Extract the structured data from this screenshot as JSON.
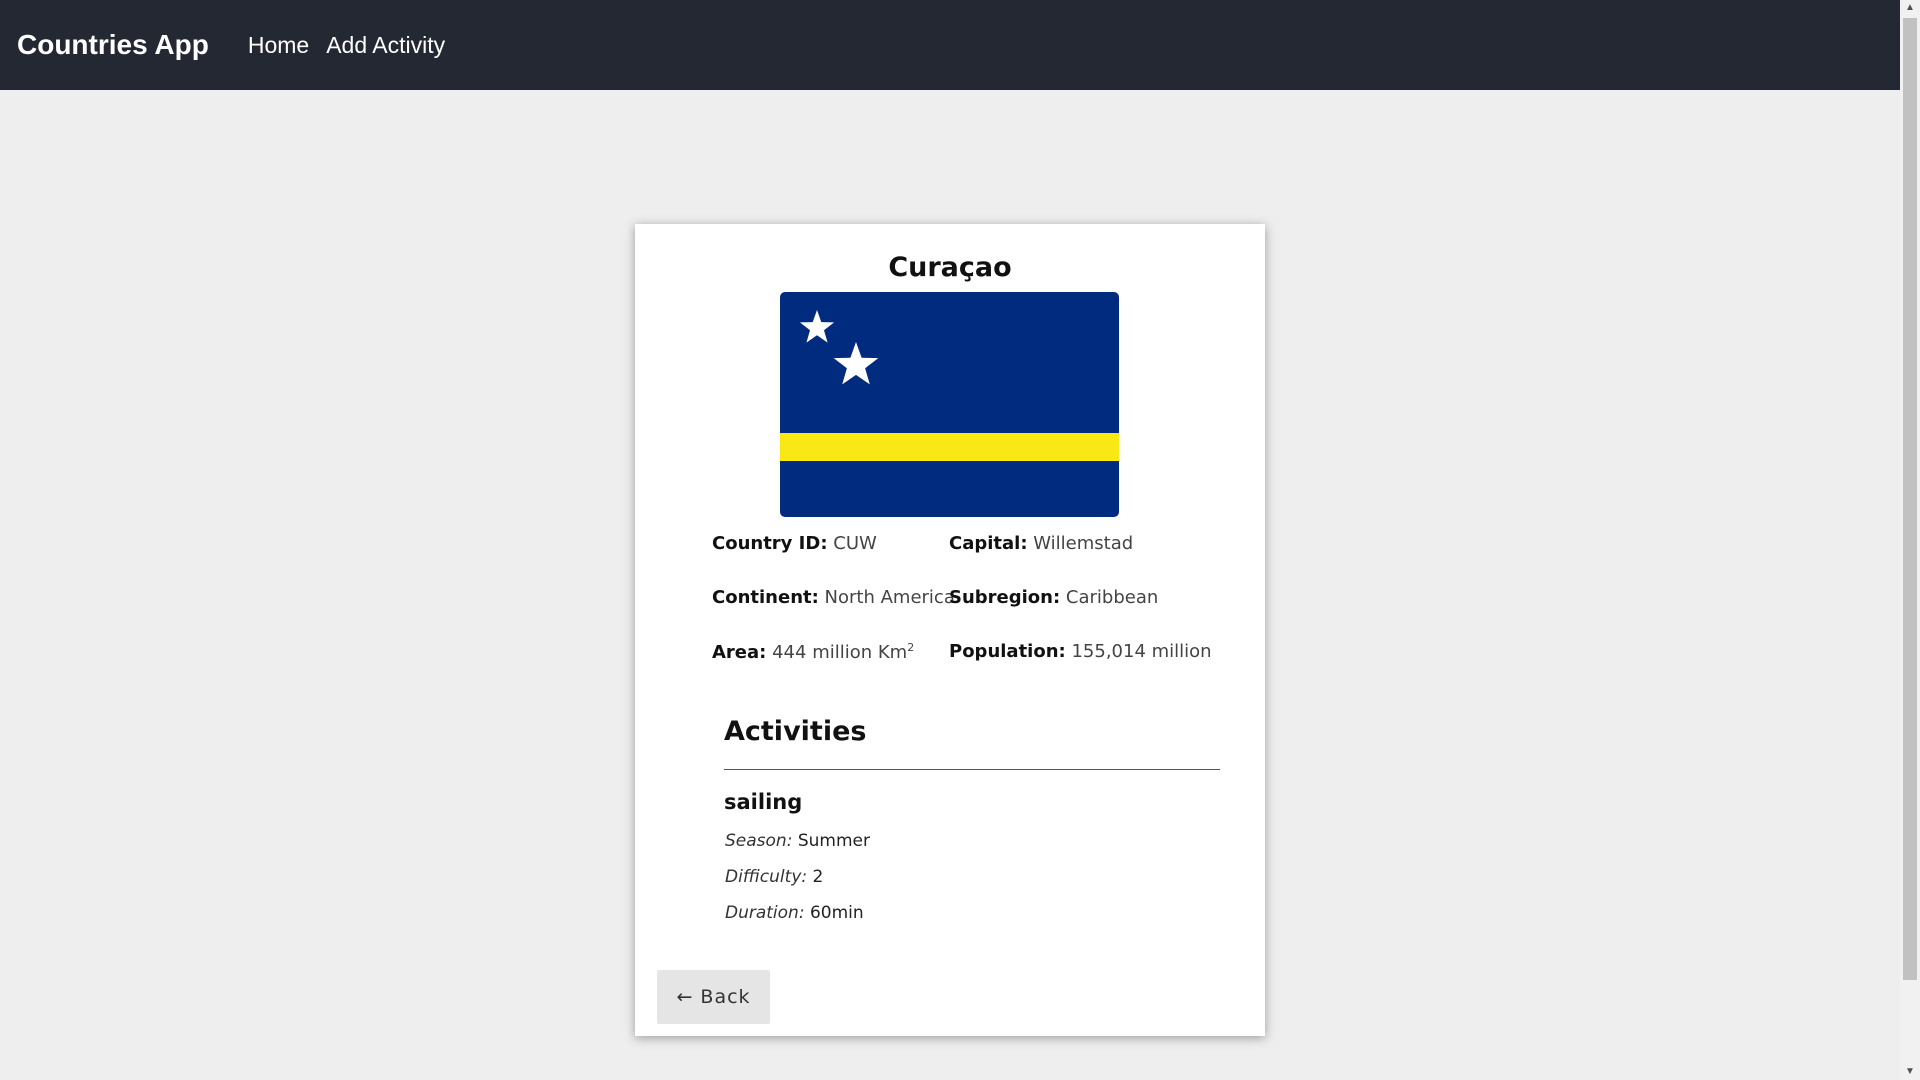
{
  "navbar": {
    "brand": "Countries App",
    "links": [
      "Home",
      "Add Activity"
    ],
    "background": "#232833"
  },
  "country": {
    "name": "Curaçao",
    "flag": {
      "description_icon": "curacao-flag",
      "colors": {
        "blue": "#002b7f",
        "yellow": "#f9e814",
        "star": "#ffffff"
      }
    },
    "fields": {
      "id_label": "Country ID:",
      "id_value": "CUW",
      "capital_label": "Capital:",
      "capital_value": "Willemstad",
      "continent_label": "Continent:",
      "continent_value": "North America",
      "subregion_label": "Subregion:",
      "subregion_value": "Caribbean",
      "area_label": "Area:",
      "area_value": "444 million Km",
      "area_sup": "2",
      "population_label": "Population:",
      "population_value": "155,014 million"
    }
  },
  "activities": {
    "title": "Activities",
    "items": [
      {
        "name": "sailing",
        "season_label": "Season:",
        "season": "Summer",
        "difficulty_label": "Difficulty:",
        "difficulty": "2",
        "duration_label": "Duration:",
        "duration": "60min"
      }
    ]
  },
  "back_button": {
    "arrow": "←",
    "label": "Back"
  }
}
